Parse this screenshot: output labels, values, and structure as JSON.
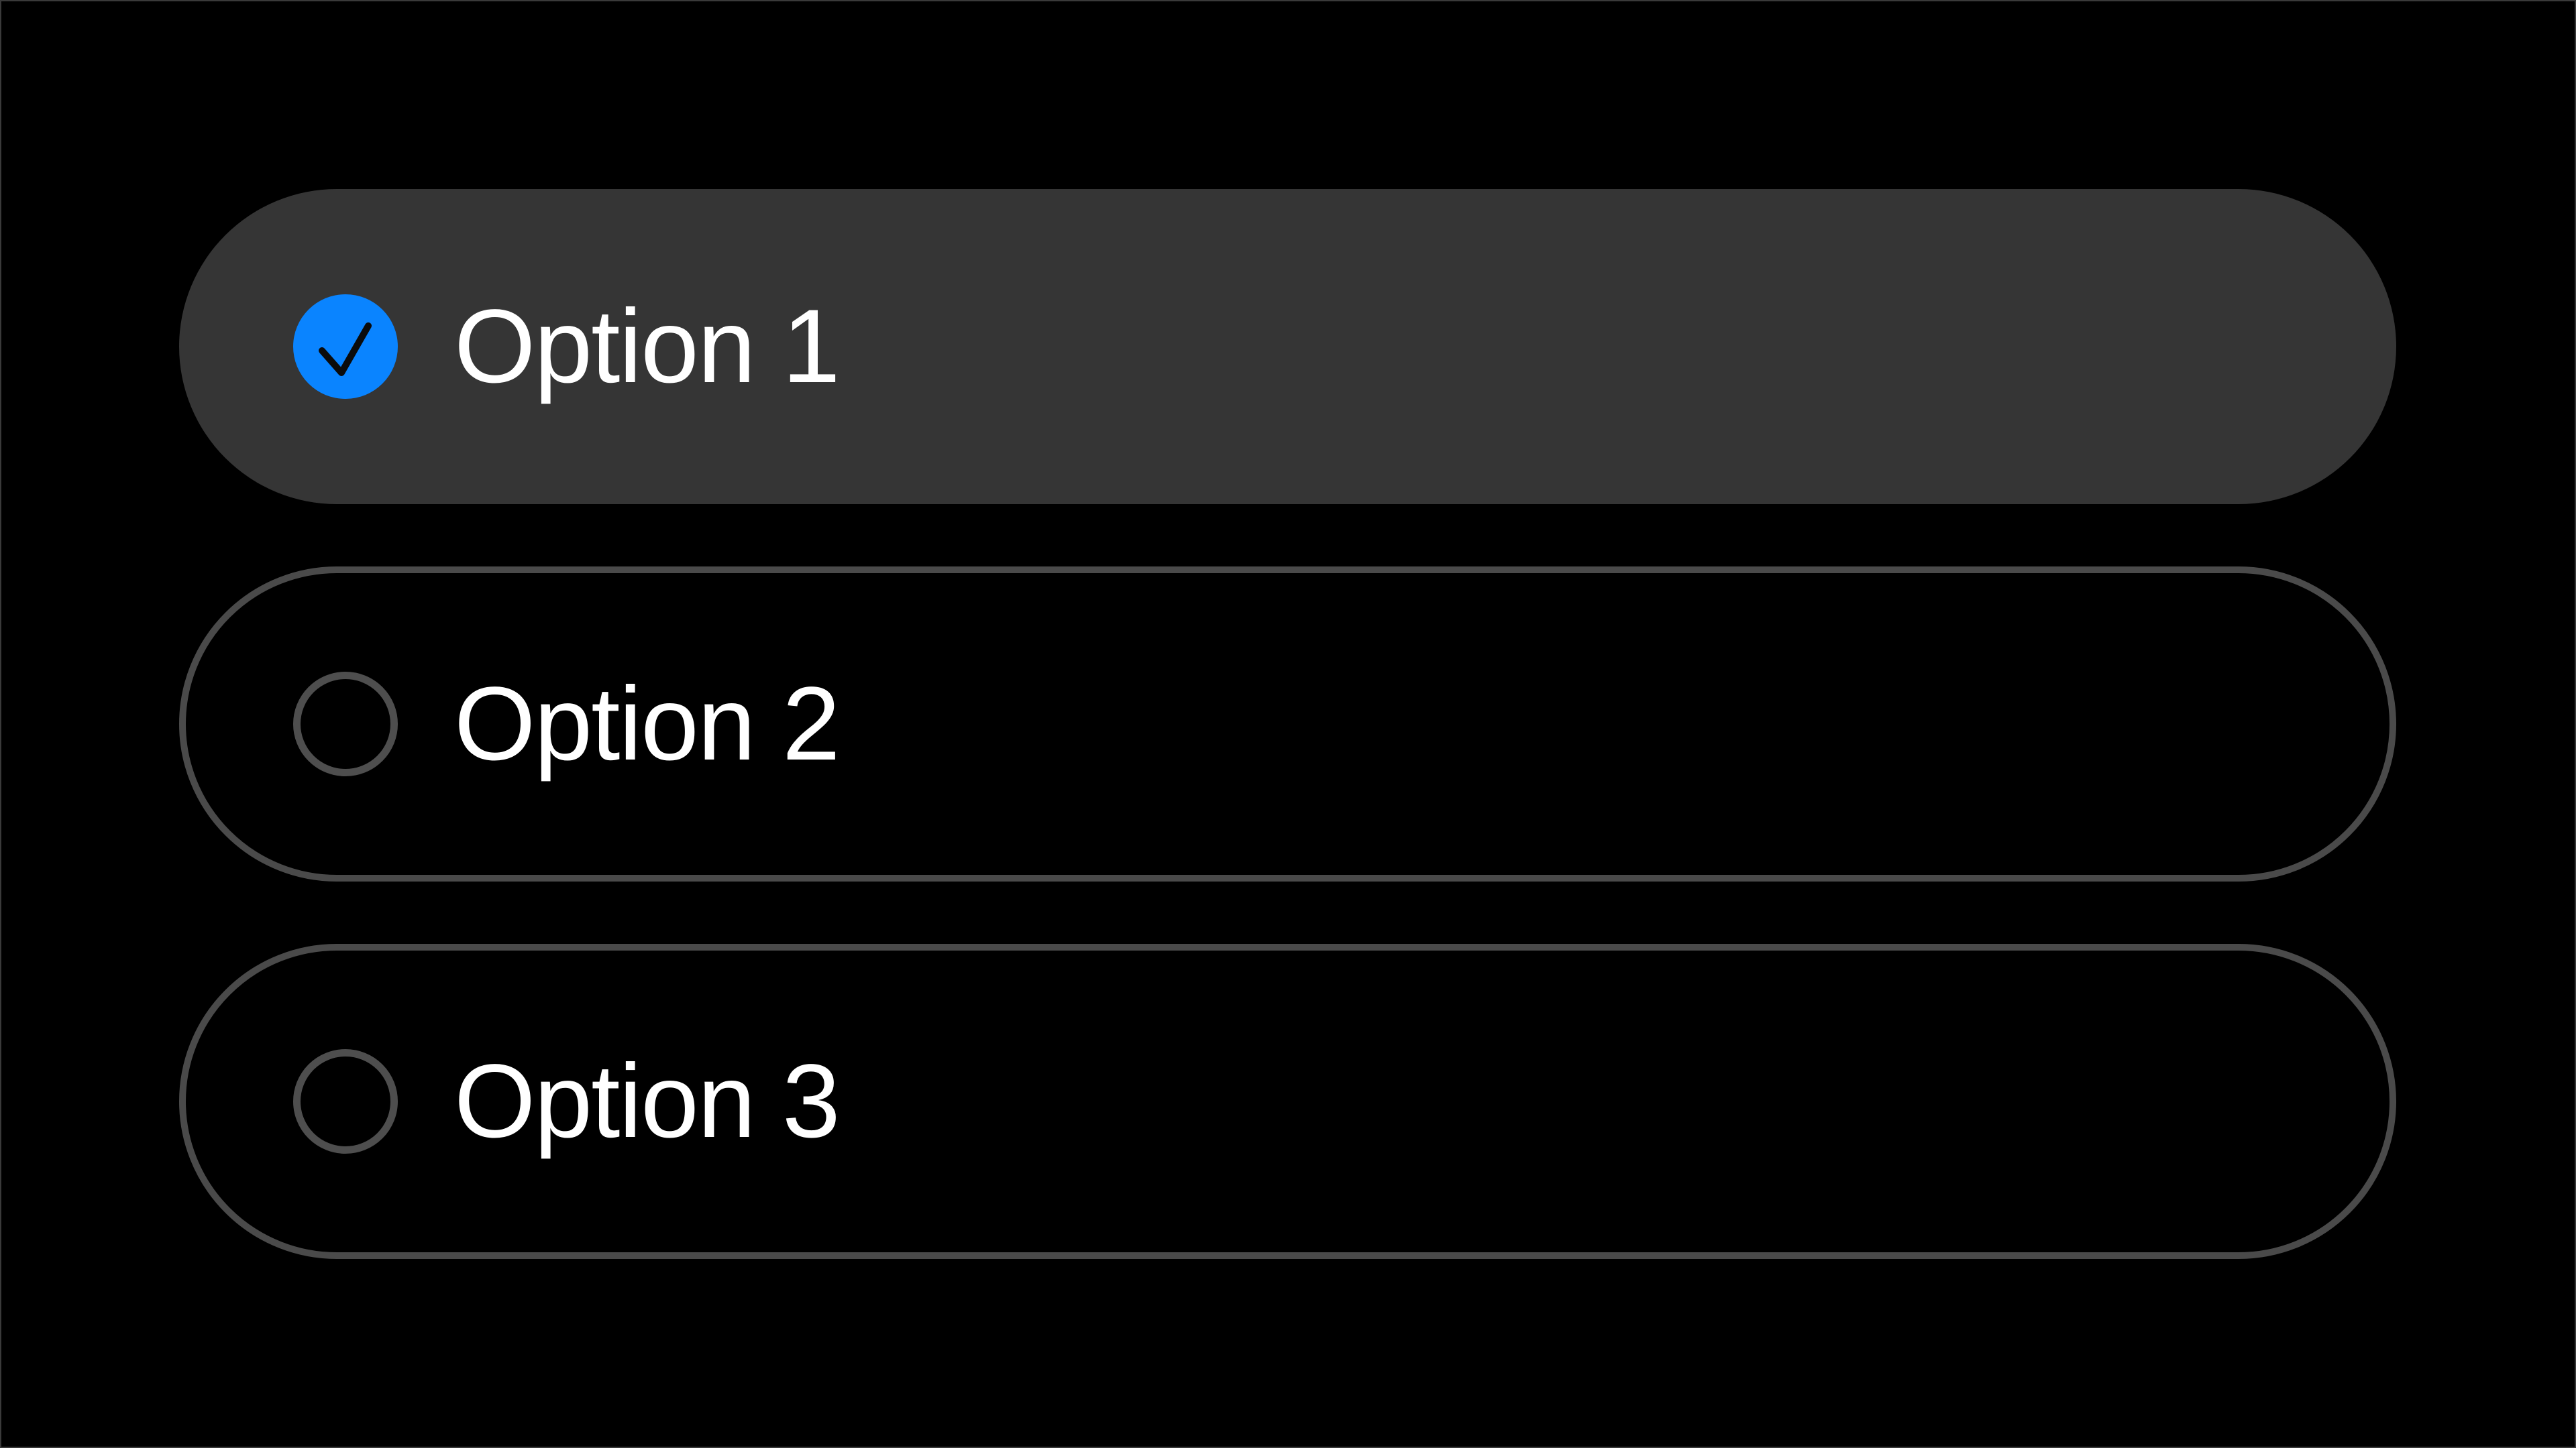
{
  "theme": {
    "accent": "#0a84ff",
    "selected_fill": "#353535",
    "outline": "#4a4a4a",
    "text": "#ffffff",
    "background": "#000000"
  },
  "options": [
    {
      "label": "Option 1",
      "selected": true,
      "icon": "checkmark-icon"
    },
    {
      "label": "Option 2",
      "selected": false,
      "icon": "empty-radio-icon"
    },
    {
      "label": "Option 3",
      "selected": false,
      "icon": "empty-radio-icon"
    }
  ]
}
